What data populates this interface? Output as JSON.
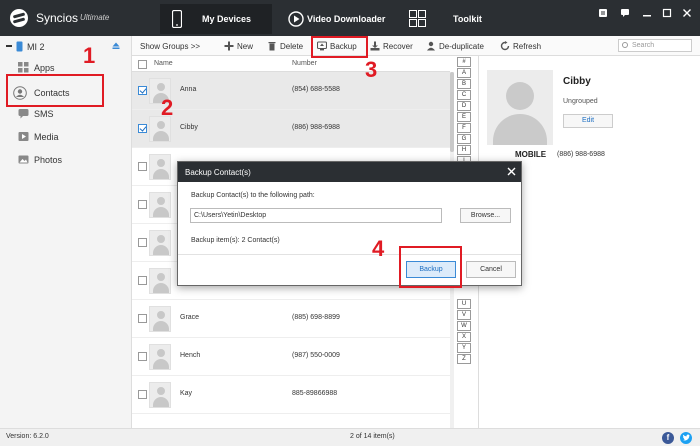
{
  "titlebar": {
    "app_name": "Syncios",
    "app_edition": "Ultimate",
    "tabs": [
      {
        "label": "My Devices",
        "icon": "phone-icon",
        "active": true
      },
      {
        "label": "Video Downloader",
        "icon": "play-icon",
        "active": false
      },
      {
        "label": "Toolkit",
        "icon": "grid-icon",
        "active": false
      }
    ],
    "controls": [
      "menu-icon",
      "comment-icon",
      "minimize-icon",
      "maximize-icon",
      "close-icon"
    ]
  },
  "sidebar": {
    "device_name": "MI 2",
    "items": [
      {
        "label": "Apps",
        "icon": "apps-icon"
      },
      {
        "label": "Contacts",
        "icon": "contacts-icon"
      },
      {
        "label": "SMS",
        "icon": "sms-icon"
      },
      {
        "label": "Media",
        "icon": "media-icon"
      },
      {
        "label": "Photos",
        "icon": "photos-icon"
      }
    ]
  },
  "toolbar": {
    "show_groups": "Show Groups >>",
    "new": "New",
    "delete": "Delete",
    "backup": "Backup",
    "recover": "Recover",
    "deduplicate": "De-duplicate",
    "refresh": "Refresh",
    "search_placeholder": "Search"
  },
  "list": {
    "headers": {
      "name": "Name",
      "number": "Number"
    },
    "rows": [
      {
        "name": "Anna",
        "number": "(854) 688-5588",
        "checked": true,
        "selected": true
      },
      {
        "name": "Cibby",
        "number": "(886) 988-6988",
        "checked": true,
        "selected": true
      },
      {
        "name": "",
        "number": "",
        "checked": false,
        "selected": false
      },
      {
        "name": "",
        "number": "",
        "checked": false,
        "selected": false
      },
      {
        "name": "",
        "number": "",
        "checked": false,
        "selected": false
      },
      {
        "name": "",
        "number": "",
        "checked": false,
        "selected": false
      },
      {
        "name": "Grace",
        "number": "(885) 698-8899",
        "checked": false,
        "selected": false
      },
      {
        "name": "Hench",
        "number": "(987) 550-0009",
        "checked": false,
        "selected": false
      },
      {
        "name": "Kay",
        "number": "885-89866988",
        "checked": false,
        "selected": false
      }
    ],
    "alphabet": [
      "#",
      "A",
      "B",
      "C",
      "D",
      "E",
      "F",
      "G",
      "H",
      "I",
      "U",
      "V",
      "W",
      "X",
      "Y",
      "Z"
    ]
  },
  "details": {
    "name": "Cibby",
    "group": "Ungrouped",
    "edit": "Edit",
    "phone_label": "MOBILE",
    "phone_value": "(886) 988-6988"
  },
  "modal": {
    "title": "Backup Contact(s)",
    "prompt": "Backup Contact(s) to the following path:",
    "path": "C:\\Users\\Yetin\\Desktop",
    "browse": "Browse...",
    "items": "Backup item(s): 2 Contact(s)",
    "backup": "Backup",
    "cancel": "Cancel"
  },
  "status": {
    "version": "Version: 6.2.0",
    "count": "2 of 14 item(s)",
    "facebook": "f"
  },
  "annotations": {
    "step1": "1",
    "step2": "2",
    "step3": "3",
    "step4": "4"
  },
  "colors": {
    "titlebar": "#2b2f33",
    "accent_blue": "#1e6fc2",
    "annotation_red": "#e01b24",
    "facebook": "#3b5998",
    "twitter": "#1da1f2"
  }
}
